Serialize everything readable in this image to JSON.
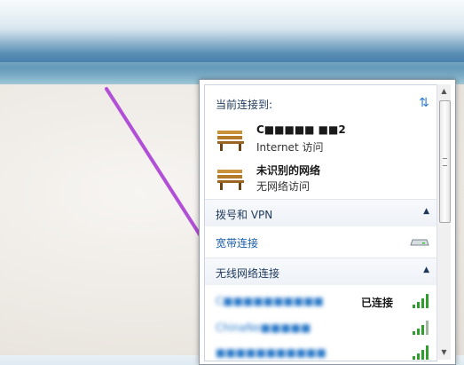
{
  "panel": {
    "header": "当前连接到:",
    "connections": [
      {
        "name": "C■■■■■ ■■2",
        "status": "Internet 访问"
      },
      {
        "name": "未识别的网络",
        "status": "无网络访问"
      }
    ],
    "dialup_section": "拨号和 VPN",
    "broadband": "宽带连接",
    "wireless_section": "无线网络连接",
    "wifi_networks": [
      {
        "name": "C■■■■■■■■■■",
        "status": "已连接"
      },
      {
        "name": "ChinaNe■■■■■",
        "status": ""
      },
      {
        "name": "■■■■■■■■■■■",
        "status": ""
      }
    ]
  },
  "icons": {
    "refresh": "refresh-icon",
    "network": "bench-network-icon",
    "modem": "modem-icon",
    "signal": "wifi-signal-icon",
    "chevron": "chevron-up-icon"
  },
  "colors": {
    "link": "#1a5ea8",
    "signal": "#2f9e2f"
  }
}
